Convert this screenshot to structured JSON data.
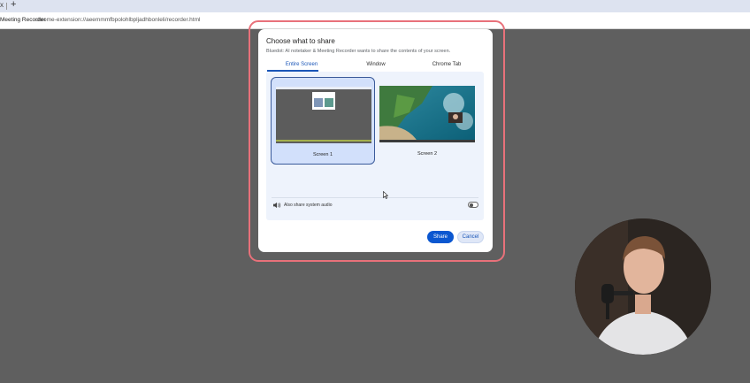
{
  "browser": {
    "tab_close_glyph": "x",
    "new_tab_glyph": "+",
    "site_label": "Meeting Recorder",
    "url": "chrome-extension://aeemmmfbpolohlbpljadhbonleli/recorder.html"
  },
  "dialog": {
    "title": "Choose what to share",
    "subtitle": "Bluedot: AI notetaker & Meeting Recorder wants to share the contents of your screen.",
    "tabs": [
      {
        "label": "Entire Screen",
        "active": true
      },
      {
        "label": "Window",
        "active": false
      },
      {
        "label": "Chrome Tab",
        "active": false
      }
    ],
    "screens": [
      {
        "label": "Screen 1",
        "selected": true
      },
      {
        "label": "Screen 2",
        "selected": false
      }
    ],
    "audio_label": "Also share system audio",
    "audio_enabled": false,
    "share_label": "Share",
    "cancel_label": "Cancel"
  },
  "colors": {
    "accent": "#0b57d0",
    "highlight_outline": "#e8717a",
    "page_background": "#5f5f5f"
  },
  "icons": [
    "speaker-icon",
    "mouse-cursor-icon"
  ]
}
